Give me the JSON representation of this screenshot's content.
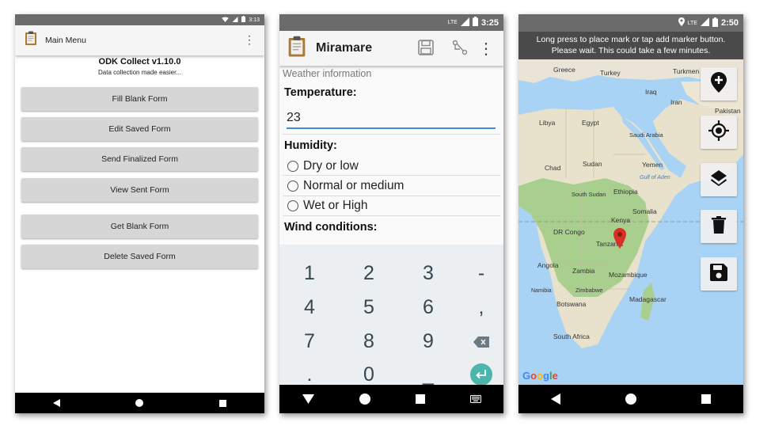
{
  "phone1": {
    "status": {
      "time": "3:13"
    },
    "appbar": {
      "title": "Main Menu"
    },
    "app_name": "ODK Collect v1.10.0",
    "app_subtitle": "Data collection made easier...",
    "buttons": [
      "Fill Blank Form",
      "Edit Saved Form",
      "Send Finalized Form",
      "View Sent Form",
      "Get Blank Form",
      "Delete Saved Form"
    ]
  },
  "phone2": {
    "status": {
      "network": "LTE",
      "time": "3:25"
    },
    "appbar": {
      "title": "Miramare"
    },
    "group_label": "Weather information",
    "temperature": {
      "label": "Temperature:",
      "value": "23"
    },
    "humidity": {
      "label": "Humidity:",
      "options": [
        "Dry or low",
        "Normal or medium",
        "Wet or High"
      ]
    },
    "wind": {
      "label": "Wind conditions:"
    },
    "keyboard": {
      "rows": [
        [
          "1",
          "2",
          "3",
          "-"
        ],
        [
          "4",
          "5",
          "6",
          ","
        ],
        [
          "7",
          "8",
          "9",
          "backspace-icon"
        ],
        [
          ".",
          "0",
          "_",
          "enter-icon"
        ]
      ],
      "accent": "#4db6ac"
    }
  },
  "phone3": {
    "status": {
      "network": "LTE",
      "time": "2:50"
    },
    "banner": {
      "line1": "Long press to place mark or tap add marker button.",
      "line2": "Please wait. This could take a few minutes."
    },
    "map_labels": {
      "greece": "Greece",
      "turkey": "Turkey",
      "turkmen": "Turkmen",
      "iraq": "Iraq",
      "iran": "Iran",
      "pakistan": "Pakistan",
      "libya": "Libya",
      "egypt": "Egypt",
      "saudi": "Saudi Arabia",
      "chad": "Chad",
      "sudan": "Sudan",
      "yemen": "Yemen",
      "gulf": "Gulf of Aden",
      "ssudan": "South Sudan",
      "ethiopia": "Ethiopia",
      "kenya": "Kenya",
      "somalia": "Somalia",
      "drc": "DR Congo",
      "tanzania": "Tanzania",
      "angola": "Angola",
      "zambia": "Zambia",
      "mozambique": "Mozambique",
      "namibia": "Namibia",
      "zimbabwe": "Zimbabwe",
      "botswana": "Botswana",
      "madagascar": "Madagascar",
      "sa": "South Africa"
    },
    "logo": "Google",
    "tools": [
      "add-marker-icon",
      "my-location-icon",
      "layers-icon",
      "delete-icon",
      "save-icon"
    ],
    "marker_color": "#d93025"
  }
}
